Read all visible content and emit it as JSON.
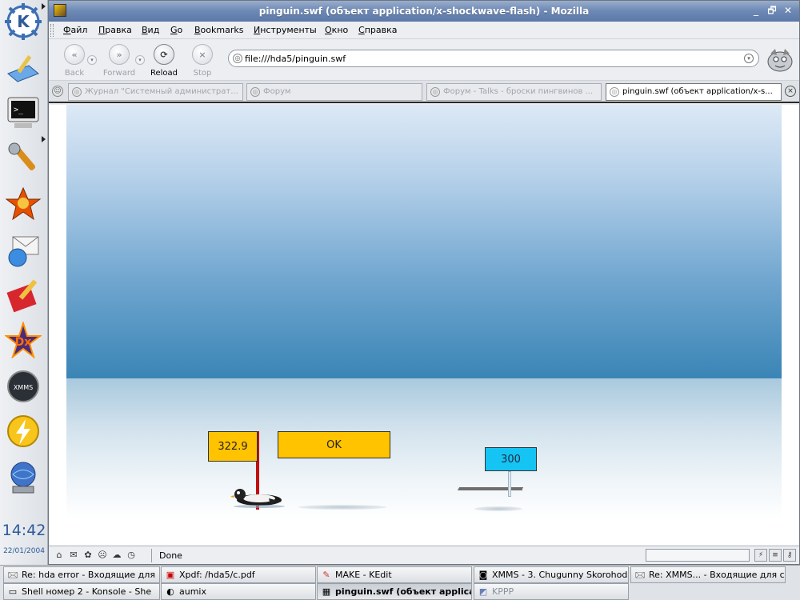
{
  "panel": {
    "clock_time": "14:42",
    "clock_date": "22/01/2004",
    "icons": [
      "kde-menu-icon",
      "desktop-icon",
      "terminal-icon",
      "control-center-icon",
      "firefox-icon",
      "mail-icon",
      "kedit-icon",
      "xdvi-icon",
      "xmms-icon",
      "power-icon",
      "network-icon"
    ]
  },
  "window": {
    "title": "pinguin.swf (объект application/x-shockwave-flash) - Mozilla",
    "controls": {
      "minimize": "_",
      "maximize": "🗗",
      "close": "✕"
    }
  },
  "menubar": {
    "items": [
      {
        "label": "Файл",
        "underline": "Ф",
        "rest": "айл"
      },
      {
        "label": "Правка",
        "underline": "П",
        "rest": "равка"
      },
      {
        "label": "Вид",
        "underline": "В",
        "rest": "ид"
      },
      {
        "label": "Go",
        "underline": "G",
        "rest": "o"
      },
      {
        "label": "Bookmarks",
        "underline": "B",
        "rest": "ookmarks"
      },
      {
        "label": "Инструменты",
        "underline": "И",
        "rest": "нструменты"
      },
      {
        "label": "Окно",
        "underline": "О",
        "rest": "кно"
      },
      {
        "label": "Справка",
        "underline": "С",
        "rest": "правка"
      }
    ]
  },
  "navbar": {
    "back_label": "Back",
    "forward_label": "Forward",
    "reload_label": "Reload",
    "stop_label": "Stop",
    "url": "file:///hda5/pinguin.swf"
  },
  "tabs": [
    {
      "label": "Журнал \"Системный администрат...",
      "active": false
    },
    {
      "label": "Форум",
      "active": false
    },
    {
      "label": "Форум - Talks - броски пингвинов ...",
      "active": false
    },
    {
      "label": "pinguin.swf (объект application/x-s...",
      "active": true
    }
  ],
  "game": {
    "score": "322.9",
    "ok_label": "OK",
    "target": "300",
    "colors": {
      "score_box": "#ffc300",
      "target_box": "#16c4f4",
      "pole": "#c01010"
    }
  },
  "statusbar": {
    "status": "Done"
  },
  "taskbar": {
    "row1": [
      {
        "label": "Re: hda error - Входящие для",
        "icon": "mail-icon"
      },
      {
        "label": "Xpdf: /hda5/c.pdf",
        "icon": "pdf-icon"
      },
      {
        "label": "MAKE - KEdit",
        "icon": "kedit-icon"
      },
      {
        "label": "XMMS - 3. Chugunny Skorohod",
        "icon": "xmms-icon"
      },
      {
        "label": "Re: XMMS... - Входящие для с",
        "icon": "mail-icon"
      }
    ],
    "row2": [
      {
        "label": "Shell номер 2 - Konsole - She",
        "icon": "terminal-icon"
      },
      {
        "label": "aumix",
        "icon": "aumix-icon"
      },
      {
        "label": "pinguin.swf (объект applica",
        "icon": "mozilla-icon",
        "active": true
      },
      {
        "label": "KPPP",
        "icon": "kppp-icon",
        "dim": true
      }
    ]
  }
}
